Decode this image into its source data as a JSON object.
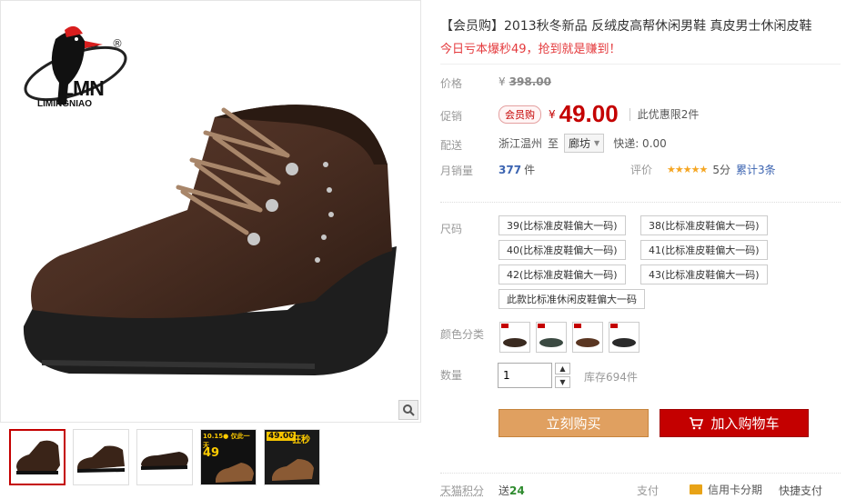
{
  "brand": {
    "logo_text": "LMN",
    "logo_sub": "LIMINGNIAO",
    "registered": "®"
  },
  "product": {
    "title": "【会员购】2013秋冬新品 反绒皮高帮休闲男鞋 真皮男士休闲皮鞋",
    "promo": "今日亏本爆秒49，抢到就是赚到！"
  },
  "price": {
    "label": "价格",
    "currency": "¥",
    "original": "398.00"
  },
  "promo_price": {
    "label": "促销",
    "badge": "会员购",
    "currency": "¥",
    "value": "49.00",
    "limit": "此优惠限2件"
  },
  "shipping": {
    "label": "配送",
    "from": "浙江温州",
    "to_label": "至",
    "to_value": "廊坊",
    "express": "快递: 0.00"
  },
  "sales": {
    "label": "月销量",
    "count": "377",
    "unit": "件",
    "review_label": "评价",
    "stars": "★★★★★",
    "score": "5分",
    "total": "累计3条"
  },
  "size": {
    "label": "尺码",
    "options": [
      "39(比标准皮鞋偏大一码)",
      "38(比标准皮鞋偏大一码)",
      "40(比标准皮鞋偏大一码)",
      "41(比标准皮鞋偏大一码)",
      "42(比标准皮鞋偏大一码)",
      "43(比标准皮鞋偏大一码)",
      "此款比标准休闲皮鞋偏大一码"
    ]
  },
  "color": {
    "label": "颜色分类",
    "swatches": [
      "#3a2a20",
      "#3b4a42",
      "#5a3622",
      "#2a2a2a"
    ]
  },
  "quantity": {
    "label": "数量",
    "value": "1",
    "stock": "库存694件"
  },
  "actions": {
    "buy": "立刻购买",
    "cart": "加入购物车"
  },
  "footer": {
    "points_label": "天猫积分",
    "points_prefix": "送",
    "points_value": "24",
    "pay_label": "支付",
    "credit": "信用卡分期",
    "quick": "快捷支付"
  },
  "thumb_banner": {
    "a_top": "10.15● 仅此一天",
    "a_price": "49",
    "b_price": "49.00",
    "b_tag": "狂秒"
  }
}
